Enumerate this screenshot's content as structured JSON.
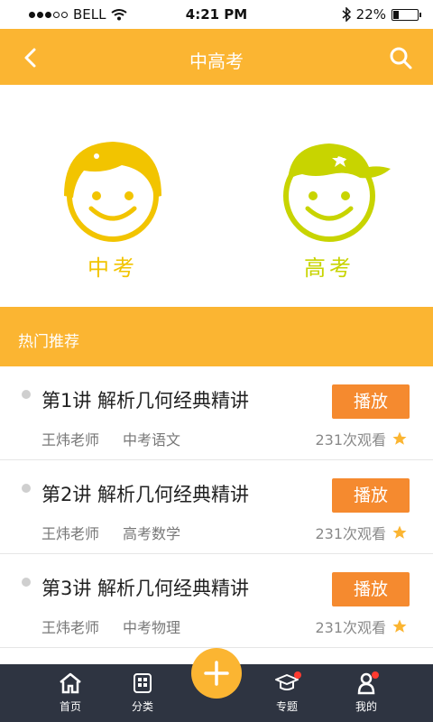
{
  "status_bar": {
    "carrier": "BELL",
    "time": "4:21 PM",
    "battery": "22%",
    "battery_level": 0.22
  },
  "navbar": {
    "title": "中高考",
    "back_icon": "chevron-left-icon",
    "search_icon": "search-icon",
    "color": "#fbb532"
  },
  "exams": [
    {
      "label": "中考",
      "color": "#f2c400"
    },
    {
      "label": "高考",
      "color": "#c8d400"
    }
  ],
  "section": {
    "title": "热门推荐"
  },
  "list": [
    {
      "title": "第1讲 解析几何经典精讲",
      "teacher": "王炜老师",
      "subject": "中考语文",
      "play_label": "播放",
      "views": "231次观看"
    },
    {
      "title": "第2讲 解析几何经典精讲",
      "teacher": "王炜老师",
      "subject": "高考数学",
      "play_label": "播放",
      "views": "231次观看"
    },
    {
      "title": "第3讲 解析几何经典精讲",
      "teacher": "王炜老师",
      "subject": "中考物理",
      "play_label": "播放",
      "views": "231次观看"
    }
  ],
  "tabbar": {
    "tabs": [
      {
        "label": "首页",
        "icon": "home-icon"
      },
      {
        "label": "分类",
        "icon": "grid-icon"
      },
      {
        "label": "专题",
        "icon": "graduation-cap-icon"
      },
      {
        "label": "我的",
        "icon": "user-icon"
      }
    ],
    "fab_icon": "plus-icon"
  }
}
